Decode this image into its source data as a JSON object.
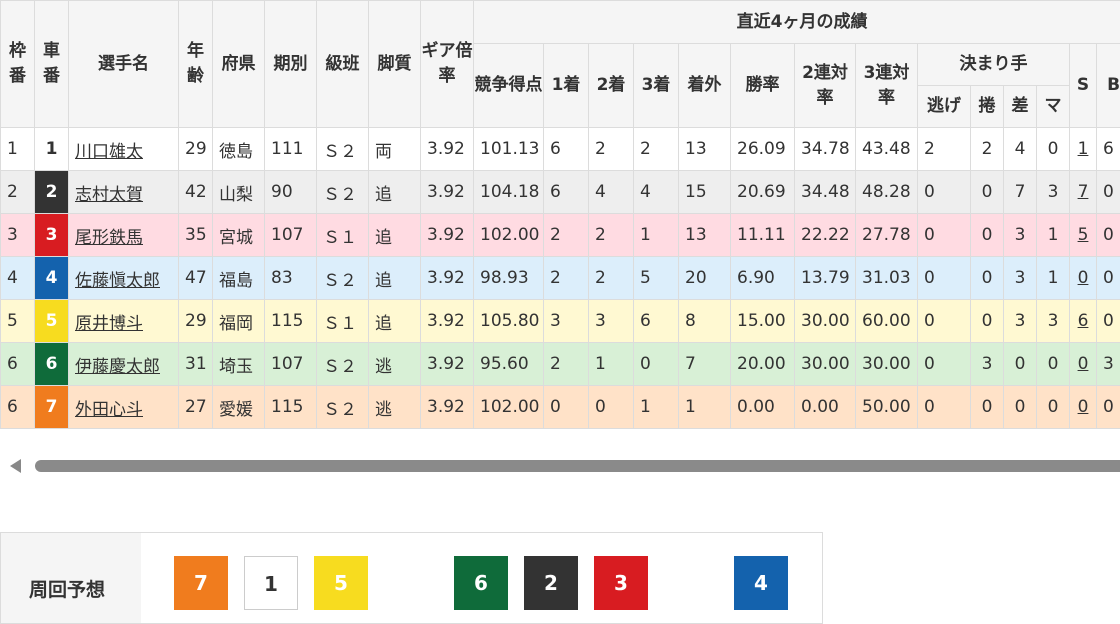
{
  "headers": {
    "waku": "枠番",
    "car": "車番",
    "name": "選手名",
    "age": "年齢",
    "pref": "府県",
    "term": "期別",
    "class": "級班",
    "style": "脚質",
    "gear": "ギア倍率",
    "recent": "直近4ヶ月の成績",
    "score": "競争得点",
    "first": "1着",
    "second": "2着",
    "third": "3着",
    "out": "着外",
    "win": "勝率",
    "ren2": "2連対率",
    "ren3": "3連対率",
    "kimari": "決まり手",
    "nige": "逃げ",
    "makuri": "捲",
    "sashi": "差",
    "mark": "マ",
    "s": "S",
    "b": "B"
  },
  "rows": [
    {
      "waku": "1",
      "car": "1",
      "name": "川口雄太",
      "age": "29",
      "pref": "徳島",
      "term": "111",
      "class": "Ｓ２",
      "style": "両",
      "gear": "3.92",
      "score": "101.13",
      "first": "6",
      "second": "2",
      "third": "2",
      "out": "13",
      "win": "26.09",
      "ren2": "34.78",
      "ren3": "43.48",
      "nige": "2",
      "makuri": "2",
      "sashi": "4",
      "mark": "0",
      "s": "1",
      "b": "6",
      "color": "#ffffff"
    },
    {
      "waku": "2",
      "car": "2",
      "name": "志村太賀",
      "age": "42",
      "pref": "山梨",
      "term": "90",
      "class": "Ｓ２",
      "style": "追",
      "gear": "3.92",
      "score": "104.18",
      "first": "6",
      "second": "4",
      "third": "4",
      "out": "15",
      "win": "20.69",
      "ren2": "34.48",
      "ren3": "48.28",
      "nige": "0",
      "makuri": "0",
      "sashi": "7",
      "mark": "3",
      "s": "7",
      "b": "0",
      "color": "#333333"
    },
    {
      "waku": "3",
      "car": "3",
      "name": "尾形鉄馬",
      "age": "35",
      "pref": "宮城",
      "term": "107",
      "class": "Ｓ１",
      "style": "追",
      "gear": "3.92",
      "score": "102.00",
      "first": "2",
      "second": "2",
      "third": "1",
      "out": "13",
      "win": "11.11",
      "ren2": "22.22",
      "ren3": "27.78",
      "nige": "0",
      "makuri": "0",
      "sashi": "3",
      "mark": "1",
      "s": "5",
      "b": "0",
      "color": "#d81c21"
    },
    {
      "waku": "4",
      "car": "4",
      "name": "佐藤愼太郎",
      "age": "47",
      "pref": "福島",
      "term": "83",
      "class": "Ｓ２",
      "style": "追",
      "gear": "3.92",
      "score": "98.93",
      "first": "2",
      "second": "2",
      "third": "5",
      "out": "20",
      "win": "6.90",
      "ren2": "13.79",
      "ren3": "31.03",
      "nige": "0",
      "makuri": "0",
      "sashi": "3",
      "mark": "1",
      "s": "0",
      "b": "0",
      "color": "#1462ad"
    },
    {
      "waku": "5",
      "car": "5",
      "name": "原井博斗",
      "age": "29",
      "pref": "福岡",
      "term": "115",
      "class": "Ｓ１",
      "style": "追",
      "gear": "3.92",
      "score": "105.80",
      "first": "3",
      "second": "3",
      "third": "6",
      "out": "8",
      "win": "15.00",
      "ren2": "30.00",
      "ren3": "60.00",
      "nige": "0",
      "makuri": "0",
      "sashi": "3",
      "mark": "3",
      "s": "6",
      "b": "0",
      "color": "#f7dc1f"
    },
    {
      "waku": "6",
      "car": "6",
      "name": "伊藤慶太郎",
      "age": "31",
      "pref": "埼玉",
      "term": "107",
      "class": "Ｓ２",
      "style": "逃",
      "gear": "3.92",
      "score": "95.60",
      "first": "2",
      "second": "1",
      "third": "0",
      "out": "7",
      "win": "20.00",
      "ren2": "30.00",
      "ren3": "30.00",
      "nige": "0",
      "makuri": "3",
      "sashi": "0",
      "mark": "0",
      "s": "0",
      "b": "3",
      "color": "#0f6b3a"
    },
    {
      "waku": "6",
      "car": "7",
      "name": "外田心斗",
      "age": "27",
      "pref": "愛媛",
      "term": "115",
      "class": "Ｓ２",
      "style": "逃",
      "gear": "3.92",
      "score": "102.00",
      "first": "0",
      "second": "0",
      "third": "1",
      "out": "1",
      "win": "0.00",
      "ren2": "0.00",
      "ren3": "50.00",
      "nige": "0",
      "makuri": "0",
      "sashi": "0",
      "mark": "0",
      "s": "0",
      "b": "0",
      "color": "#f07c1e"
    }
  ],
  "forecast": {
    "label": "周回予想",
    "boxes": [
      {
        "num": "7",
        "color": "#f07c1e"
      },
      {
        "num": "1",
        "color": "#ffffff"
      },
      {
        "num": "5",
        "color": "#f7dc1f"
      },
      {
        "num": "6",
        "color": "#0f6b3a"
      },
      {
        "num": "2",
        "color": "#333333"
      },
      {
        "num": "3",
        "color": "#d81c21"
      },
      {
        "num": "4",
        "color": "#1462ad"
      }
    ]
  },
  "icons": {
    "scroll_left": "triangle-left-icon"
  }
}
